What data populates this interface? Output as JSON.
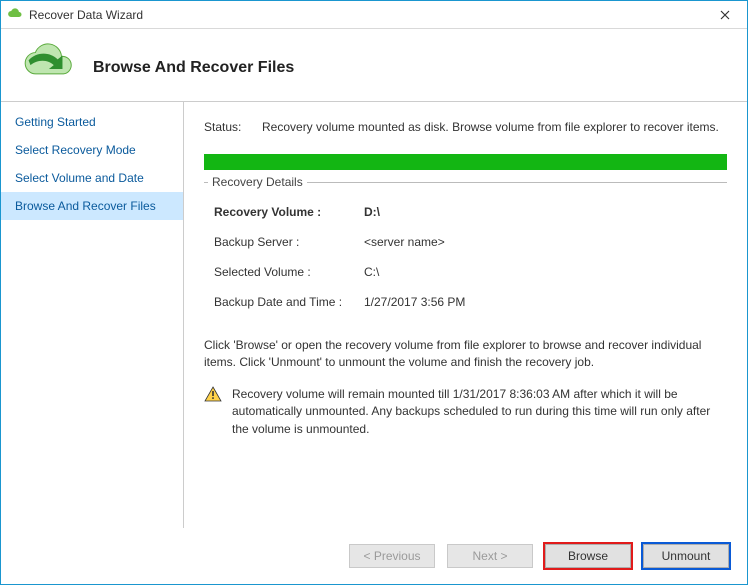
{
  "window": {
    "title": "Recover Data Wizard"
  },
  "header": {
    "heading": "Browse And Recover Files"
  },
  "sidebar": {
    "steps": [
      {
        "label": "Getting Started"
      },
      {
        "label": "Select Recovery Mode"
      },
      {
        "label": "Select Volume and Date"
      },
      {
        "label": "Browse And Recover Files"
      }
    ],
    "active_index": 3
  },
  "status": {
    "label": "Status:",
    "text": "Recovery volume mounted as disk. Browse volume from file explorer to recover items."
  },
  "details": {
    "legend": "Recovery Details",
    "rows": {
      "recovery_volume": {
        "label": "Recovery Volume :",
        "value": "D:\\"
      },
      "backup_server": {
        "label": "Backup Server :",
        "value": "<server name>"
      },
      "selected_volume": {
        "label": "Selected Volume :",
        "value": "C:\\"
      },
      "backup_time": {
        "label": "Backup Date and Time :",
        "value": "1/27/2017 3:56 PM"
      }
    }
  },
  "instructions": "Click 'Browse' or open the recovery volume from file explorer to browse and recover individual items. Click 'Unmount' to unmount the volume and finish the recovery job.",
  "warning": "Recovery volume will remain mounted till 1/31/2017 8:36:03 AM after which it will be automatically unmounted. Any backups scheduled to run during this time will run only after the volume is unmounted.",
  "buttons": {
    "previous": "< Previous",
    "next": "Next >",
    "browse": "Browse",
    "unmount": "Unmount"
  }
}
